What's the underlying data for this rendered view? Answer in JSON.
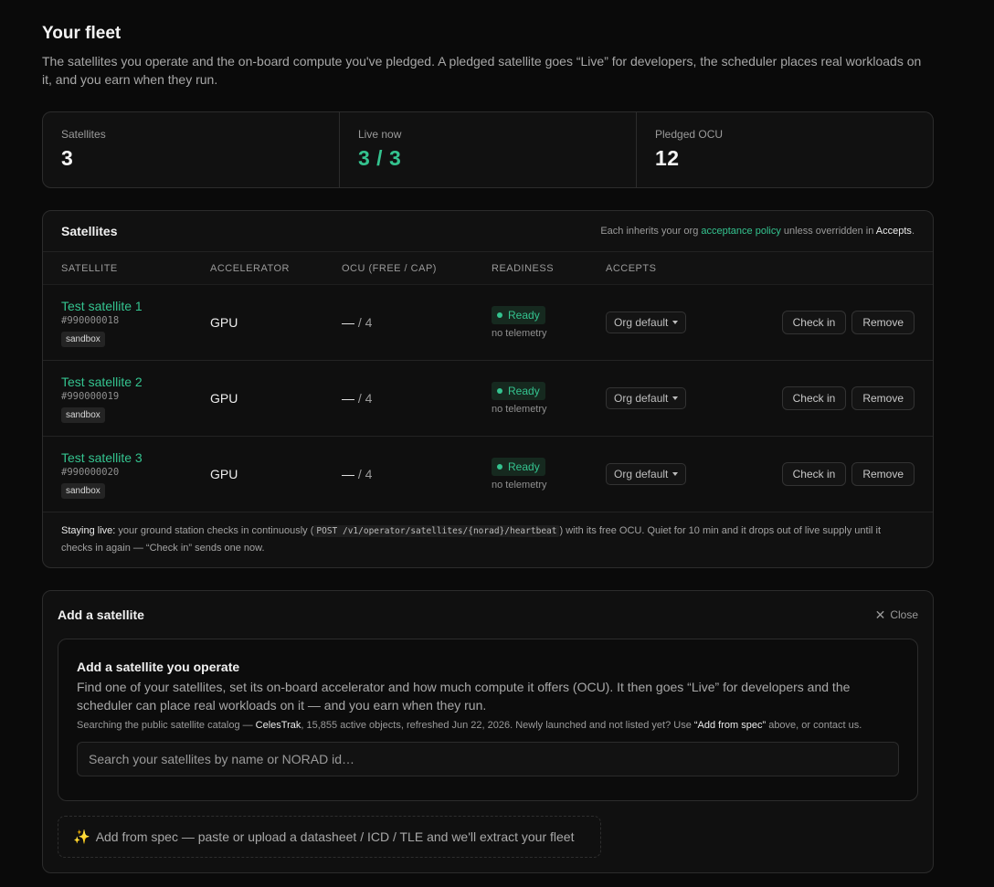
{
  "header": {
    "title": "Your fleet",
    "description": "The satellites you operate and the on-board compute you've pledged. A pledged satellite goes “Live” for developers, the scheduler places real workloads on it, and you earn when they run."
  },
  "stats": [
    {
      "label": "Satellites",
      "value": "3"
    },
    {
      "label": "Live now",
      "value": "3 / 3"
    },
    {
      "label": "Pledged OCU",
      "value": "12"
    }
  ],
  "satellites_panel": {
    "title": "Satellites",
    "note_prefix": "Each inherits your org ",
    "note_link": "acceptance policy",
    "note_middle": " unless overridden in ",
    "note_strong": "Accepts",
    "note_suffix": ".",
    "columns": [
      "Satellite",
      "Accelerator",
      "OCU (free / cap)",
      "Readiness",
      "Accepts"
    ],
    "rows": [
      {
        "name": "Test satellite 1",
        "id": "#990000018",
        "tag": "sandbox",
        "accelerator": "GPU",
        "ocu_free": "—",
        "ocu_cap": " / 4",
        "readiness": "Ready",
        "telemetry": "no telemetry",
        "accepts": "Org default",
        "checkin": "Check in",
        "remove": "Remove"
      },
      {
        "name": "Test satellite 2",
        "id": "#990000019",
        "tag": "sandbox",
        "accelerator": "GPU",
        "ocu_free": "—",
        "ocu_cap": " / 4",
        "readiness": "Ready",
        "telemetry": "no telemetry",
        "accepts": "Org default",
        "checkin": "Check in",
        "remove": "Remove"
      },
      {
        "name": "Test satellite 3",
        "id": "#990000020",
        "tag": "sandbox",
        "accelerator": "GPU",
        "ocu_free": "—",
        "ocu_cap": " / 4",
        "readiness": "Ready",
        "telemetry": "no telemetry",
        "accepts": "Org default",
        "checkin": "Check in",
        "remove": "Remove"
      }
    ],
    "footer_strong": "Staying live:",
    "footer_text1": " your ground station checks in continuously (",
    "footer_code": "POST /v1/operator/satellites/{norad}/heartbeat",
    "footer_text2": ") with its free OCU. Quiet for 10 min and it drops out of live supply until it checks in again — “Check in” sends one now."
  },
  "add_panel": {
    "title": "Add a satellite",
    "close_label": "Close",
    "inner_title": "Add a satellite you operate",
    "inner_desc": "Find one of your satellites, set its on-board accelerator and how much compute it offers (OCU). It then goes “Live” for developers and the scheduler can place real workloads on it — and you earn when they run.",
    "note_prefix": "Searching the public satellite catalog — ",
    "note_source": "CelesTrak",
    "note_middle": ", 15,855 active objects, refreshed Jun 22, 2026. Newly launched and not listed yet? Use ",
    "note_strong": "“Add from spec”",
    "note_suffix": " above, or contact us.",
    "search_placeholder": "Search your satellites by name or NORAD id…",
    "spec_button": "Add from spec — paste or upload a datasheet / ICD / TLE and we'll extract your fleet"
  },
  "colors": {
    "accent": "#34c38f",
    "background": "#0a0a0a"
  }
}
